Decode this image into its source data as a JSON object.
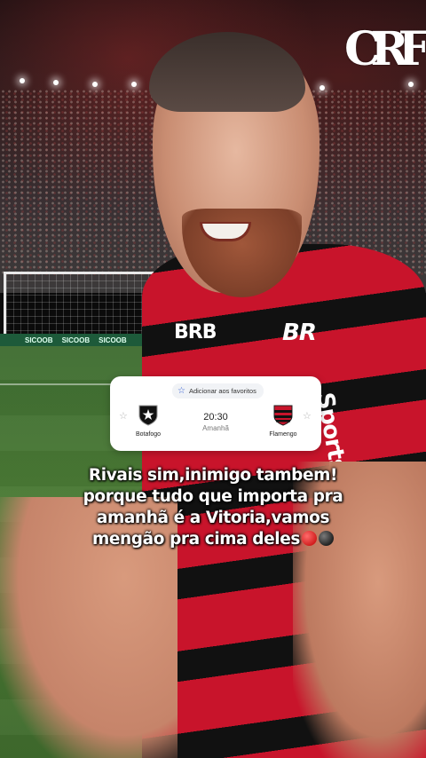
{
  "watermark": {
    "crest_text": "CRF",
    "crest_label": "Flamengo crest watermark"
  },
  "match_card": {
    "favorite_label": "Adicionar aos favoritos",
    "home_team": "Botafogo",
    "away_team": "Flamengo",
    "kickoff_time": "20:30",
    "kickoff_day": "Amanhã",
    "colors": {
      "accent_star": "#2f5bd3",
      "flamengo_red": "#c8142b",
      "botafogo_black": "#111111"
    }
  },
  "caption": {
    "lines": [
      "Rivais sim,inimigo tambem!",
      "porque tudo que importa pra",
      "amanhã é a Vitoria,vamos",
      "mengão pra cima deles"
    ],
    "emojis": [
      "red-circle",
      "black-circle"
    ]
  },
  "shirt_print": {
    "sponsor_left": "BRB",
    "sponsor_right": "BR",
    "sleeve": "Sportsbet"
  },
  "background_ads": [
    "SICOOB",
    "SICOOB",
    "SICOOB"
  ]
}
